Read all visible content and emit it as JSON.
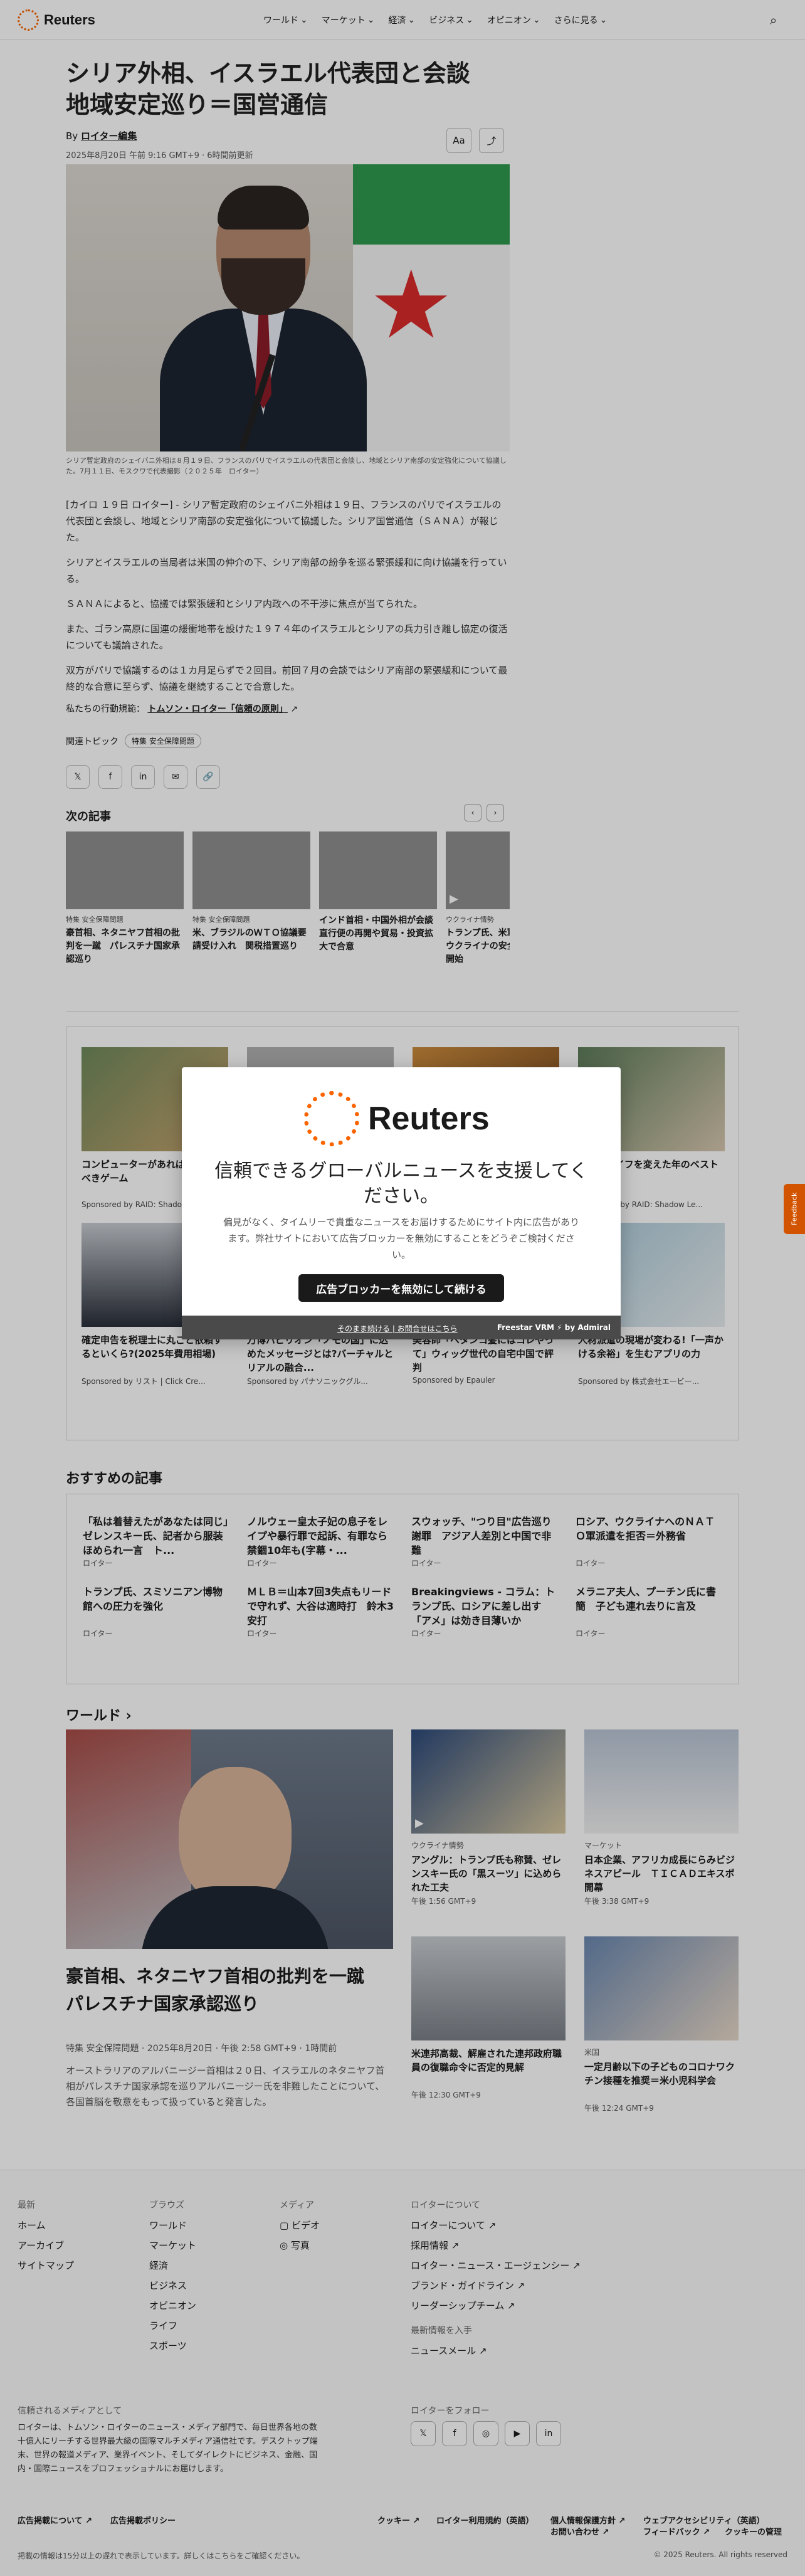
{
  "header": {
    "logo_text": "Reuters",
    "nav": [
      "ワールド",
      "マーケット",
      "経済",
      "ビジネス",
      "オピニオン",
      "さらに見る"
    ]
  },
  "article": {
    "headline": "シリア外相、イスラエル代表団と会談　地域安定巡り＝国営通信",
    "byline_prefix": "By",
    "byline_author": "ロイター編集",
    "dateline": "2025年8月20日 午前 9:16 GMT+9 · 6時間前更新",
    "tools": {
      "text_size": "Aa",
      "share": "⤴"
    },
    "caption": "シリア暫定政府のシェイバニ外相は８月１９日、フランスのパリでイスラエルの代表団と会談し、地域とシリア南部の安定強化について協議した。7月１１日、モスクワで代表撮影（２０２５年　ロイター）",
    "paragraphs": [
      "[カイロ １９日 ロイター] - シリア暫定政府のシェイバニ外相は１９日、フランスのパリでイスラエルの代表団と会談し、地域とシリア南部の安定強化について協議した。シリア国営通信（ＳＡＮＡ）が報じた。",
      "シリアとイスラエルの当局者は米国の仲介の下、シリア南部の紛争を巡る緊張緩和に向け協議を行っている。",
      "ＳＡＮＡによると、協議では緊張緩和とシリア内政への不干渉に焦点が当てられた。",
      "また、ゴラン高原に国連の緩衝地帯を設けた１９７４年のイスラエルとシリアの兵力引き離し協定の復活についても議論された。",
      "双方がパリで協議するのは１カ月足らずで２回目。前回７月の会談ではシリア南部の緊張緩和について最終的な合意に至らず、協議を継続することで合意した。"
    ],
    "principles_prefix": "私たちの行動規範：",
    "principles_link": "トムソン・ロイター「信頼の原則」",
    "topics_label": "関連トピック",
    "topic_chip": "特集 安全保障問題",
    "share_icons": [
      "𝕏",
      "f",
      "in",
      "✉",
      "🔗"
    ]
  },
  "next": {
    "title": "次の記事",
    "items": [
      {
        "kicker": "特集 安全保障問題",
        "headline": "豪首相、ネタニヤフ首相の批判を一蹴　パレスチナ国家承認巡り"
      },
      {
        "kicker": "特集 安全保障問題",
        "headline": "米、ブラジルのＷＴＯ協議要請受け入れ　関税措置巡り"
      },
      {
        "kicker": "",
        "headline": "インド首相・中国外相が会談　直行便の再開や貿易・投資拡大で合意"
      },
      {
        "kicker": "ウクライナ情勢",
        "headline": "トランプ氏、米軍派遣を否定　ウクライナの安全保証」検討開始"
      }
    ]
  },
  "sponsored": {
    "items": [
      {
        "title": "コンピューターがあれば絶対該すべきゲーム",
        "source": "Sponsored by RAID: Shadow Legends"
      },
      {
        "title": "",
        "source": ""
      },
      {
        "title": "",
        "source": ""
      },
      {
        "title": "ゲームライフを変えた年のベストゲーム",
        "source": "Sponsored by RAID: Shadow Le..."
      },
      {
        "title": "確定申告を税理士に丸ごと依頼するといくら?(2025年費用相場)",
        "source": "Sponsored by リスト | Click Cre..."
      },
      {
        "title": "万博パビリオン「ノモの国」に込めたメッセージとは?バーチャルとリアルの融合...",
        "source": "Sponsored by パナソニックグル..."
      },
      {
        "title": "美容師「ベタンコ髪にはコレやって」ウィッグ世代の自宅中国で評判",
        "source": "Sponsored by Epauler"
      },
      {
        "title": "人材派遣の現場が変わる!「一声かける余裕」を生むアプリの力",
        "source": "Sponsored by 株式会社エービー..."
      }
    ]
  },
  "modal": {
    "logo_text": "Reuters",
    "title": "信頼できるグローバルニュースを支援してください。",
    "body": "偏見がなく、タイムリーで貴重なニュースをお届けするためにサイト内に広告があります。弊社サイトにおいて広告ブロッカーを無効にすることをどうぞご検討ください。",
    "button": "広告ブロッカーを無効にして続ける",
    "bar_links": "そのまま続ける | お問合せはこちら",
    "bar_brand": "Freestar VRM ⚡ by Admiral"
  },
  "feedback": "Feedback",
  "recommended": {
    "title": "おすすめの記事",
    "items": [
      {
        "headline": "「私は着替えたがあなたは同じ」ゼレンスキー氏、記者から服装ほめられ一言　ト...",
        "source": "ロイター"
      },
      {
        "headline": "ノルウェー皇太子妃の息子をレイプや暴行罪で起訴、有罪なら禁錮10年も(字幕・...",
        "source": "ロイター"
      },
      {
        "headline": "スウォッチ、\"つり目\"広告巡り謝罪　アジア人差別と中国で非難",
        "source": "ロイター"
      },
      {
        "headline": "ロシア、ウクライナへのＮＡＴＯ軍派遣を拒否＝外務省",
        "source": "ロイター"
      },
      {
        "headline": "トランプ氏、スミソニアン博物館への圧力を強化",
        "source": "ロイター"
      },
      {
        "headline": "ＭＬＢ＝山本7回3失点もリードで守れず、大谷は適時打　鈴木3安打",
        "source": "ロイター"
      },
      {
        "headline": "Breakingviews - コラム：トランプ氏、ロシアに差し出す「アメ」は効き目薄いか",
        "source": "ロイター"
      },
      {
        "headline": "メラニア夫人、プーチン氏に書簡　子ども連れ去りに言及",
        "source": "ロイター"
      }
    ]
  },
  "world": {
    "label": "ワールド ›",
    "hero": {
      "headline": "豪首相、ネタニヤフ首相の批判を一蹴　パレスチナ国家承認巡り",
      "meta": "特集 安全保障問題 · 2025年8月20日 · 午後 2:58 GMT+9 · 1時間前",
      "desc": "オーストラリアのアルバニージー首相は２０日、イスラエルのネタニヤフ首相がパレスチナ国家承認を巡りアルバニージー氏を非難したことについて、各国首脳を敬意をもって扱っていると発言した。"
    },
    "cards": [
      {
        "kicker": "ウクライナ情勢",
        "headline": "アングル：トランプ氏も称賛、ゼレンスキー氏の「黒スーツ」に込められた工夫",
        "time": "午後 1:56 GMT+9"
      },
      {
        "kicker": "マーケット",
        "headline": "日本企業、アフリカ成長にらみビジネスアピール　ＴＩＣＡＤエキスポ開幕",
        "time": "午後 3:38 GMT+9"
      },
      {
        "kicker": "",
        "headline": "米連邦高裁、解雇された連邦政府職員の復職命令に否定的見解",
        "time": "午後 12:30 GMT+9"
      },
      {
        "kicker": "米国",
        "headline": "一定月齢以下の子どものコロナワクチン接種を推奨＝米小児科学会",
        "time": "午後 12:24 GMT+9"
      }
    ]
  },
  "footer": {
    "col1": {
      "head": "最新",
      "items": [
        "ホーム",
        "アーカイブ",
        "サイトマップ"
      ]
    },
    "col2": {
      "head": "ブラウズ",
      "items": [
        "ワールド",
        "マーケット",
        "経済",
        "ビジネス",
        "オピニオン",
        "ライフ",
        "スポーツ"
      ]
    },
    "col3": {
      "head": "メディア",
      "items": [
        "▢ ビデオ",
        "◎ 写真"
      ]
    },
    "col4": {
      "head": "ロイターについて",
      "items": [
        "ロイターについて ↗",
        "採用情報 ↗",
        "ロイター・ニュース・エージェンシー ↗",
        "ブランド・ガイドライン ↗",
        "リーダーシップチーム ↗"
      ]
    },
    "col4b": {
      "head": "最新情報を入手",
      "items": [
        "ニュースメール ↗"
      ]
    },
    "about_head": "信頼されるメディアとして",
    "about_text": "ロイターは、トムソン・ロイターのニュース・メディア部門で、毎日世界各地の数十億人にリーチする世界最大級の国際マルチメディア通信社です。デスクトップ端末、世界の報道メディア、業界イベント、そしてダイレクトにビジネス、金融、国内・国際ニュースをプロフェッショナルにお届けします。",
    "follow_head": "ロイターをフォロー",
    "social": [
      "𝕏",
      "f",
      "◎",
      "▶",
      "in"
    ],
    "legal_left": [
      "広告掲載について ↗",
      "広告掲載ポリシー"
    ],
    "legal_right": [
      "クッキー ↗",
      "ロイター利用規約（英語）",
      "個人情報保護方針 ↗",
      "ウェブアクセシビリティ（英語）",
      "お問い合わせ ↗",
      "フィードバック ↗",
      "クッキーの管理"
    ],
    "copy_left": "掲載の情報は15分以上の遅れで表示しています。詳しくはこちらをご確認ください。",
    "copy_right": "© 2025 Reuters. All rights reserved"
  }
}
